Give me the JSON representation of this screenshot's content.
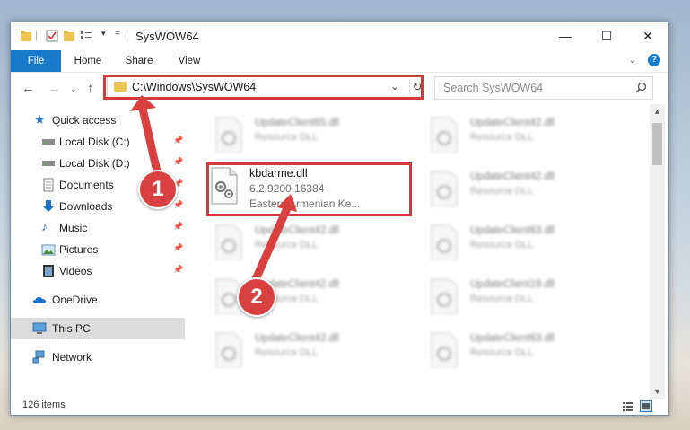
{
  "window": {
    "title": "SysWOW64",
    "controls": {
      "minimize": "—",
      "maximize": "☐",
      "close": "✕"
    }
  },
  "ribbon": {
    "tabs": [
      "File",
      "Home",
      "Share",
      "View"
    ],
    "help": "?"
  },
  "address": {
    "path": "C:\\Windows\\SysWOW64",
    "search_placeholder": "Search SysWOW64"
  },
  "nav_pane": {
    "quick_access": "Quick access",
    "items": [
      {
        "label": "Local Disk (C:)",
        "icon": "drive-icon",
        "pinned": true
      },
      {
        "label": "Local Disk (D:)",
        "icon": "drive-icon",
        "pinned": true
      },
      {
        "label": "Documents",
        "icon": "documents-icon",
        "pinned": true
      },
      {
        "label": "Downloads",
        "icon": "downloads-icon",
        "pinned": true
      },
      {
        "label": "Music",
        "icon": "music-icon",
        "pinned": true
      },
      {
        "label": "Pictures",
        "icon": "pictures-icon",
        "pinned": true
      },
      {
        "label": "Videos",
        "icon": "videos-icon",
        "pinned": true
      }
    ],
    "onedrive": "OneDrive",
    "this_pc": "This PC",
    "network": "Network"
  },
  "files": {
    "selected": {
      "name": "kbdarme.dll",
      "version": "6.2.9200.16384",
      "description": "Eastern Armenian Ke..."
    },
    "blurred": [
      {
        "name": "UpdateClient65.dll",
        "desc": "Resource DLL"
      },
      {
        "name": "UpdateClient42.dll",
        "desc": "Resource DLL"
      },
      {
        "name": "UpdateClient42.dll",
        "desc": "Resource DLL"
      },
      {
        "name": "UpdateClient42.dll",
        "desc": "Resource DLL"
      },
      {
        "name": "UpdateClient63.dll",
        "desc": "Resource DLL"
      },
      {
        "name": "UpdateClient42.dll",
        "desc": "Resource DLL"
      },
      {
        "name": "UpdateClient19.dll",
        "desc": "Resource DLL"
      },
      {
        "name": "UpdateClient42.dll",
        "desc": "Resource DLL"
      },
      {
        "name": "UpdateClient63.dll",
        "desc": "Resource DLL"
      }
    ]
  },
  "status": {
    "item_count": "126 items"
  },
  "annotations": {
    "step1": "1",
    "step2": "2"
  },
  "colors": {
    "accent": "#1979ca",
    "highlight": "#d33b3b",
    "badge": "#d94040"
  }
}
